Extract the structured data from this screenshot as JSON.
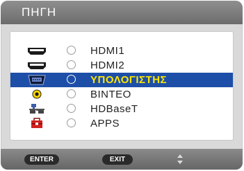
{
  "window": {
    "title": "ΠΗΓΗ"
  },
  "sources": [
    {
      "label": "HDMI1",
      "icon": "hdmi-port-icon",
      "selected": false
    },
    {
      "label": "HDMI2",
      "icon": "hdmi-port-icon",
      "selected": false
    },
    {
      "label": "ΥΠΟΛΟΓΙΣΤΗΣ",
      "icon": "vga-computer-port-icon",
      "selected": true
    },
    {
      "label": "ΒΙΝΤΕΟ",
      "icon": "video-rca-icon",
      "selected": false
    },
    {
      "label": "HDBaseT",
      "icon": "network-hdbaset-icon",
      "selected": false
    },
    {
      "label": "APPS",
      "icon": "apps-toolbox-icon",
      "selected": false
    }
  ],
  "footer": {
    "enter_label": "ENTER",
    "exit_label": "EXIT",
    "scroll_icon": "up-down-arrows-icon"
  },
  "colors": {
    "selection_bg": "#1e4fa8",
    "selection_text": "#ffe600",
    "header_bg": "#7d7d7d"
  }
}
